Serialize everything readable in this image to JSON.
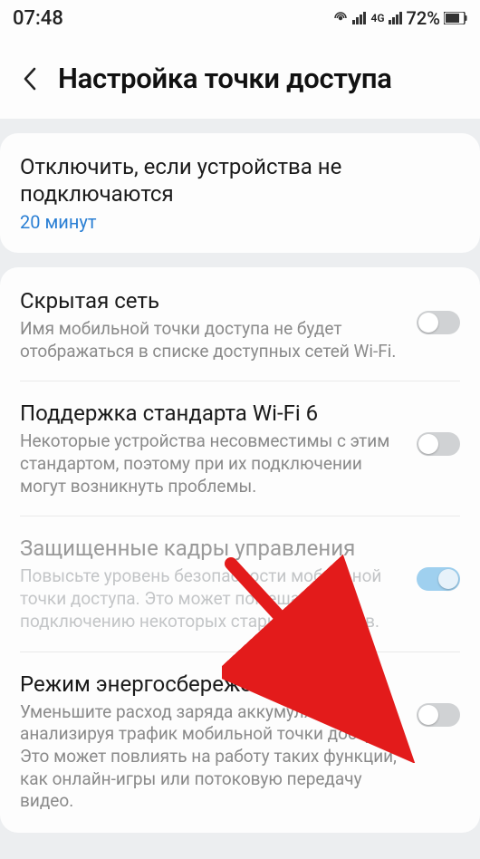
{
  "status": {
    "time": "07:48",
    "battery_pct": "72%",
    "net_label_4g": "4G"
  },
  "header": {
    "title": "Настройка точки доступа"
  },
  "timeout": {
    "title": "Отключить, если устройства не подключаются",
    "value": "20 минут"
  },
  "hidden_net": {
    "title": "Скрытая сеть",
    "desc": "Имя мобильной точки доступа не будет отображаться в списке доступных сетей Wi-Fi.",
    "enabled": false
  },
  "wifi6": {
    "title": "Поддержка стандарта Wi-Fi 6",
    "desc": "Некоторые устройства несовместимы с этим стандартом, поэтому при их подключении могут возникнуть проблемы.",
    "enabled": false
  },
  "pmf": {
    "title": "Защищенные кадры управления",
    "desc": "Повысьте уровень безопасности мобильной точки доступа. Это может помешать подключению некоторых старых устройств.",
    "enabled": true,
    "locked": true
  },
  "power_save": {
    "title": "Режим энергосбережения",
    "desc": "Уменьшите расход заряда аккумулятора, анализируя трафик мобильной точки доступа. Это может повлиять на работу таких функций, как онлайн-игры или потоковую передачу видео.",
    "enabled": false
  },
  "colors": {
    "accent": "#2a7fd4",
    "arrow": "#e31b1b"
  }
}
